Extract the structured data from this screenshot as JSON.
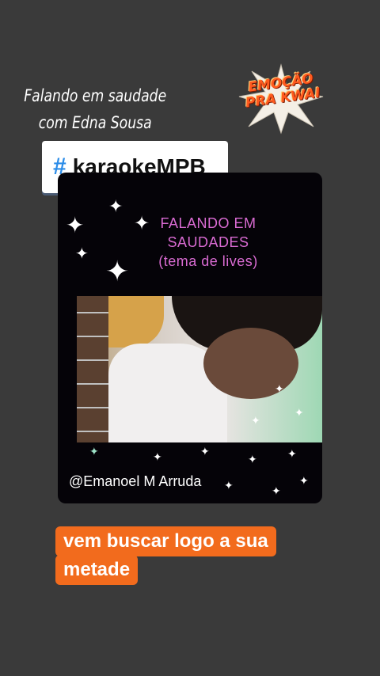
{
  "caption": {
    "line1": "Falando em saudade",
    "line2": "com Edna Sousa"
  },
  "sticker": {
    "line1": "EMOÇÃO",
    "line2": "PRA KWAI"
  },
  "hashtag": {
    "symbol": "#",
    "text": "karaokeMPB"
  },
  "card": {
    "title_line1": "FALANDO EM",
    "title_line2": "SAUDADES",
    "title_line3": "(tema de lives)",
    "credit": "@Emanoel M Arruda"
  },
  "bottom_text": {
    "line1": "vem buscar logo a sua",
    "line2": "metade"
  },
  "colors": {
    "background": "#3a3a3a",
    "accent_orange": "#f26b1d",
    "hashtag_blue": "#2b8ce8",
    "title_pink": "#d96bd2"
  }
}
